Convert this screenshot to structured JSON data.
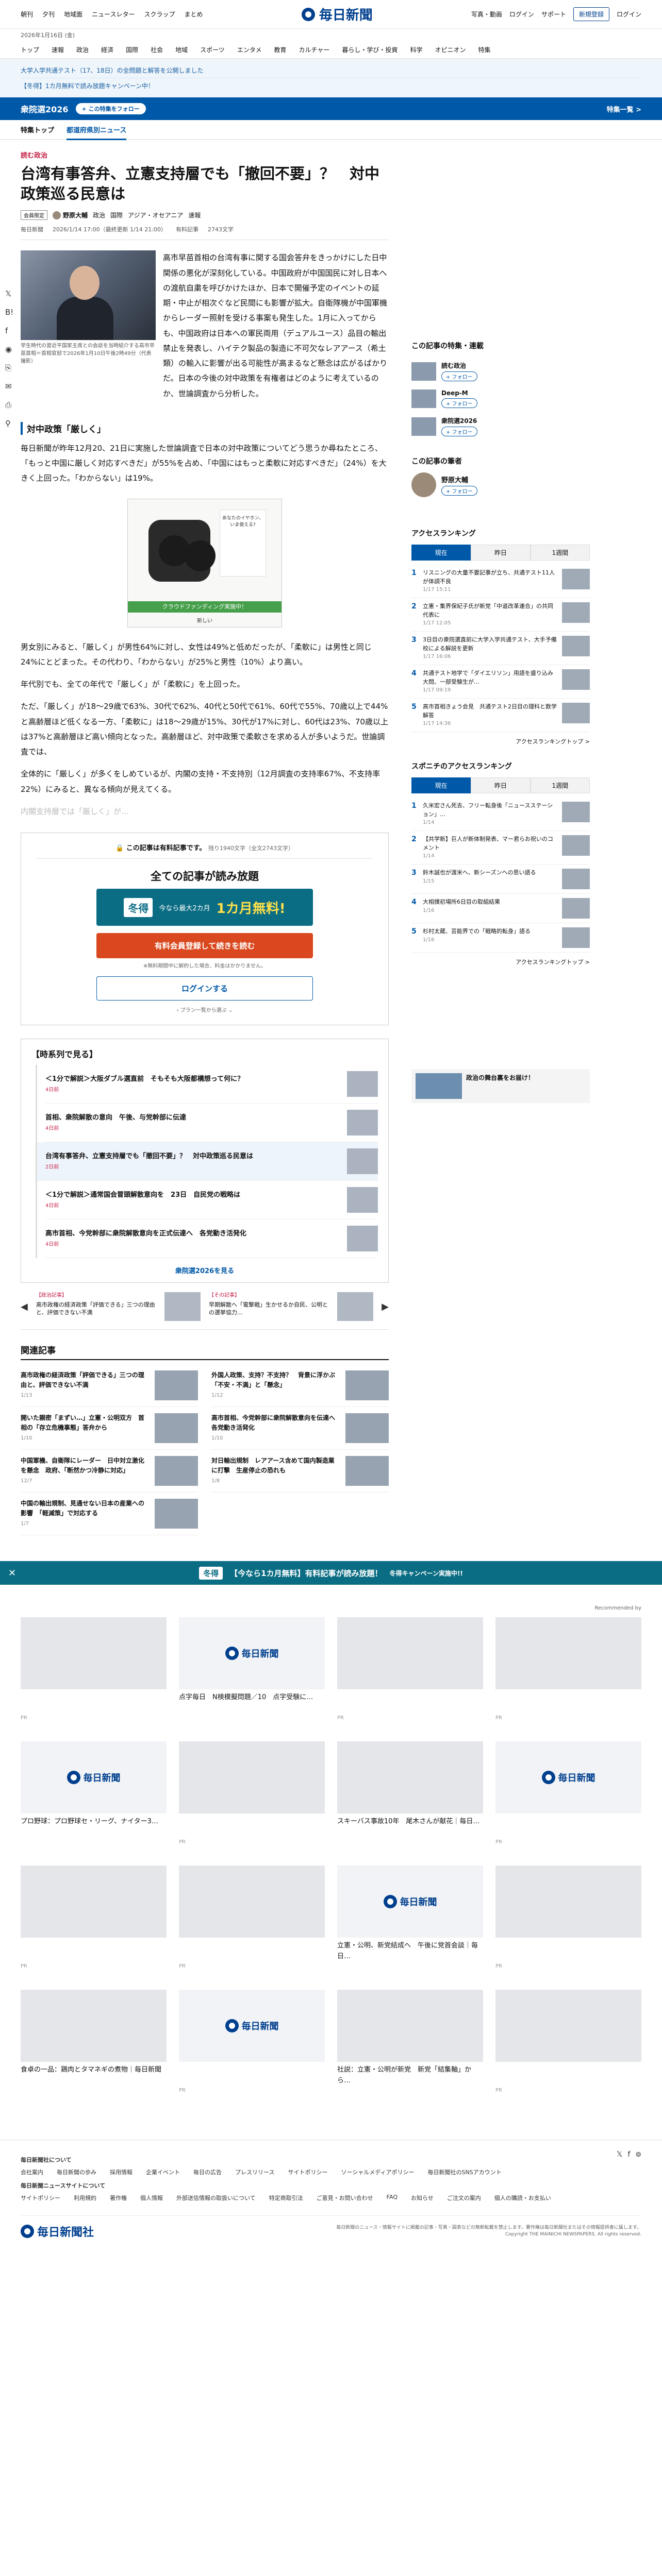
{
  "header": {
    "left_links": [
      "朝刊",
      "夕刊",
      "地域面",
      "ニュースレター",
      "スクラップ",
      "まとめ"
    ],
    "logo": "毎日新聞",
    "right_links": [
      "写真・動画",
      "ログイン",
      "サポート"
    ],
    "register": "新規登録",
    "login": "ログイン",
    "date": "2026年1月16日 (金)"
  },
  "categories": [
    "トップ",
    "速報",
    "政治",
    "経済",
    "国際",
    "社会",
    "地域",
    "スポーツ",
    "エンタメ",
    "教育",
    "カルチャー",
    "暮らし・学び・投資",
    "科学",
    "オピニオン",
    "特集"
  ],
  "notices": [
    "大学入学共通テスト（17、18日）の全問題と解答を公開しました",
    "【冬得】1カ月無料で読み放題キャンペーン中！"
  ],
  "election": {
    "title": "衆院選2026",
    "follow": "+ この特集をフォロー",
    "special": "特集一覧 >"
  },
  "subtabs": [
    "特集トップ",
    "都道府県別ニュース"
  ],
  "article": {
    "category": "読む政治",
    "headline": "台湾有事答弁、立憲支持層でも「撤回不要」？　対中政策巡る民意は",
    "badge": "会員限定",
    "author": "野原大輔",
    "tags": [
      "政治",
      "国際",
      "アジア・オセアニア",
      "速報"
    ],
    "meta": [
      "毎日新聞",
      "2026/1/14 17:00（最終更新 1/14 21:00）",
      "有料記事",
      "2743文字"
    ],
    "caption": "学生時代の習近平国家主席との会談を当時紹介する高市早苗首相＝首相官邸で2026年1月10日午後2時49分（代表撮影）",
    "paragraphs": [
      "高市早苗首相の台湾有事に関する国会答弁をきっかけにした日中関係の悪化が深刻化している。中国政府が中国国民に対し日本への渡航自粛を呼びかけたほか、日本で開催予定のイベントの延期・中止が相次ぐなど民間にも影響が拡大。自衛隊機が中国軍機からレーダー照射を受ける事案も発生した。1月に入ってからも、中国政府は日本への軍民両用（デュアルユース）品目の輸出禁止を発表し、ハイテク製品の製造に不可欠なレアアース（希土類）の輸入に影響が出る可能性が高まるなど懸念は広がるばかりだ。日本の今後の対中政策を有権者はどのように考えているのか、世論調査から分析した。",
      "毎日新聞が昨年12月20、21日に実施した世論調査で日本の対中政策についてどう思うか尋ねたところ、「もっと中国に厳しく対応すべきだ」が55%を占め、「中国にはもっと柔軟に対応すべきだ」（24%）を大きく上回った。「わからない」は19%。",
      "男女別にみると、「厳しく」が男性64%に対し、女性は49%と低めだったが、「柔軟に」は男性と同じ24%にとどまった。その代わり、「わからない」が25%と男性（10%）より高い。",
      "年代別でも、全ての年代で「厳しく」が「柔軟に」を上回った。",
      "ただ、「厳しく」が18〜29歳で63%、30代で62%、40代と50代で61%、60代で55%、70歳以上で44%と高齢層ほど低くなる一方、「柔軟に」は18〜29歳が15%、30代が17%に対し、60代は23%、70歳以上は37%と高齢層ほど高い傾向となった。高齢層ほど、対中政策で柔軟さを求める人が多いようだ。世論調査では、",
      "全体的に「厳しく」が多くをしめているが、内閣の支持・不支持別（12月調査の支持率67%、不支持率22%）にみると、異なる傾向が見えてくる。"
    ],
    "faded": "内閣支持層では「厳しく」が…",
    "section_heading": "対中政策「厳しく」"
  },
  "ad": {
    "card": "あなたのイヤホン、いま使える?",
    "band": "クラウドファンディング実施中！",
    "sub": "新しい"
  },
  "paywall": {
    "notice": "この記事は有料記事です。",
    "notice_small": "残り1940文字（全文2743文字）",
    "headline": "全ての記事が読み放題",
    "campaign_tag": "冬得",
    "campaign_text": "今なら最大2カ月",
    "campaign_free": "1カ月無料!",
    "subscribe": "有料会員登録して続きを読む",
    "subscribe_note": "※無料期間中に解約した場合、料金はかかりません。",
    "login": "ログインする",
    "plans": "プラン一覧から選ぶ"
  },
  "series": {
    "title": "【時系列で見る】",
    "items": [
      {
        "title": "＜1分で解説＞大阪ダブル選直前　そもそも大阪都構想って何に？",
        "date": "4日前"
      },
      {
        "title": "首相、衆院解散の意向　午後、与党幹部に伝達",
        "date": "4日前"
      },
      {
        "title": "台湾有事答弁、立憲支持層でも「撤回不要」？　対中政策巡る民意は",
        "date": "2日前"
      },
      {
        "title": "＜1分で解説＞通常国会冒頭解散意向を　23日　自民党の戦略は",
        "date": "4日前"
      },
      {
        "title": "高市首相、今党幹部に衆院解散意向を正式伝達へ　各党動き活発化",
        "date": "4日前"
      }
    ],
    "more": "衆院選2026を見る"
  },
  "carousel": [
    {
      "tag": "【政治記事】",
      "title": "高市政権の経済政策「評価できる」三つの理由と、評価できない不満"
    },
    {
      "tag": "【その記事】",
      "title": "早期解散へ「電撃戦」生かせるか自民、公明との選挙協力…"
    }
  ],
  "related": {
    "heading": "関連記事",
    "items": [
      {
        "title": "高市政権の経済政策「評価できる」三つの理由と、評価できない不満",
        "date": "1/13"
      },
      {
        "title": "外国人政策、支持？不支持？　背景に浮かぶ「不安・不満」と「懸念」",
        "date": "1/12"
      },
      {
        "title": "開いた親密「まずい…」立憲・公明双方　首相の「存立危機事態」答弁から",
        "date": "1/10"
      },
      {
        "title": "高市首相、今党幹部に衆院解散意向を伝達へ　各党動き活発化",
        "date": "1/10"
      },
      {
        "title": "中国軍機、自衛隊にレーダー　日中対立激化を懸念　政府、「断然かつ冷静に対応」",
        "date": "12/7"
      },
      {
        "title": "対日輸出規制　レアアース含めて国内製造業に打撃　生産停止の恐れも",
        "date": "1/8"
      },
      {
        "title": "中国の輸出規制、見通せない日本の産業への影響　「軽減策」で対応する",
        "date": "1/7"
      }
    ]
  },
  "sidebar": {
    "features_h": "この記事の特集・連載",
    "features": [
      "読む政治",
      "Deep-M",
      "衆院選2026"
    ],
    "follow": "+ フォロー",
    "writer_h": "この記事の筆者",
    "writer": "野原大輔",
    "ranking_h": "アクセスランキング",
    "tabs": [
      "現在",
      "昨日",
      "1週間"
    ],
    "ranking": [
      {
        "t": "リスニングの大量不要記事が立ち、共通テスト11人が体調不良",
        "d": "1/17 15:11"
      },
      {
        "t": "立憲・集界保紀子氏が新党「中道改革連合」の共同代表に",
        "d": "1/17 12:05"
      },
      {
        "t": "3日目の衆院選直前に大学入学共通テスト、大手予備校による解説を更新",
        "d": "1/17 16:06"
      },
      {
        "t": "共通テスト地学で「ダイエリソン」用語を盛り込み大問、一部受験生が…",
        "d": "1/17 09:19"
      },
      {
        "t": "高市首相きょう会見　共通テスト2日目の理科と数学解答",
        "d": "1/17 14:36"
      }
    ],
    "ranking_more": "アクセスランキングトップ >",
    "sports_h": "スポニチのアクセスランキング",
    "sports": [
      {
        "t": "久米宏さん死去、フリー転身後「ニュースステーション」…",
        "d": "1/14"
      },
      {
        "t": "【共学新】巨人が新体制発表、マー君らお祝いのコメント",
        "d": "1/14"
      },
      {
        "t": "鈴木誠也が渡米へ、新シーズンへの思い語る",
        "d": "1/15"
      },
      {
        "t": "大相撲初場所6日目の取組結果",
        "d": "1/16"
      },
      {
        "t": "杉村太蔵、芸能界での「戦略的転身」語る",
        "d": "1/16"
      }
    ],
    "banner": "政治の舞台裏をお届け！"
  },
  "bottom_campaign": {
    "tag": "冬得",
    "text": "【今なら1カ月無料】有料記事が読み放題！",
    "sub": "冬得キャンペーン実施中!!"
  },
  "recommend": {
    "by": "Recommended by",
    "items": [
      {
        "title": "",
        "pr": "PR"
      },
      {
        "title": "点字毎日　N検模擬問題／10　点字受験に…",
        "pr": ""
      },
      {
        "title": "",
        "pr": "PR"
      },
      {
        "title": "",
        "pr": "PR"
      },
      {
        "title": "プロ野球：プロ野球セ・リーグ、ナイター3…",
        "pr": ""
      },
      {
        "title": "",
        "pr": "PR"
      },
      {
        "title": "スキーバス事故10年　尾木さんが献花｜毎日…",
        "pr": ""
      },
      {
        "title": "",
        "pr": "PR"
      },
      {
        "title": "",
        "pr": "PR"
      },
      {
        "title": "",
        "pr": "PR"
      },
      {
        "title": "立憲・公明、新党結成へ　午後に党首会談｜毎日…",
        "pr": ""
      },
      {
        "title": "",
        "pr": "PR"
      },
      {
        "title": "食卓の一品：鶏肉とタマネギの煮物｜毎日新聞",
        "pr": ""
      },
      {
        "title": "",
        "pr": "PR"
      },
      {
        "title": "社説：立憲・公明が新党　新党「結集軸」から…",
        "pr": ""
      },
      {
        "title": "",
        "pr": "PR"
      }
    ]
  },
  "footer": {
    "h1": "毎日新聞社について",
    "links1": [
      "会社案内",
      "毎日新聞の歩み",
      "採用情報",
      "企業イベント",
      "毎日の広告",
      "プレスリリース",
      "サイトポリシー",
      "ソーシャルメディアポリシー",
      "毎日新聞社のSNSアカウント"
    ],
    "h2": "毎日新聞ニュースサイトについて",
    "links2": [
      "サイトポリシー",
      "利用規約",
      "著作権",
      "個人情報",
      "外部送信情報の取扱いについて",
      "特定商取引法",
      "ご意見・お問い合わせ",
      "FAQ",
      "お知らせ",
      "ご注文の案内",
      "個人の購読・お支払い"
    ],
    "logo": "毎日新聞社",
    "copyright": "毎日新聞のニュース・情報サイトに掲載の記事・写真・図表などの無断転載を禁止します。著作権は毎日新聞社またはその情報提供者に属します。 Copyright THE MAINICHI NEWSPAPERS. All rights reserved."
  }
}
